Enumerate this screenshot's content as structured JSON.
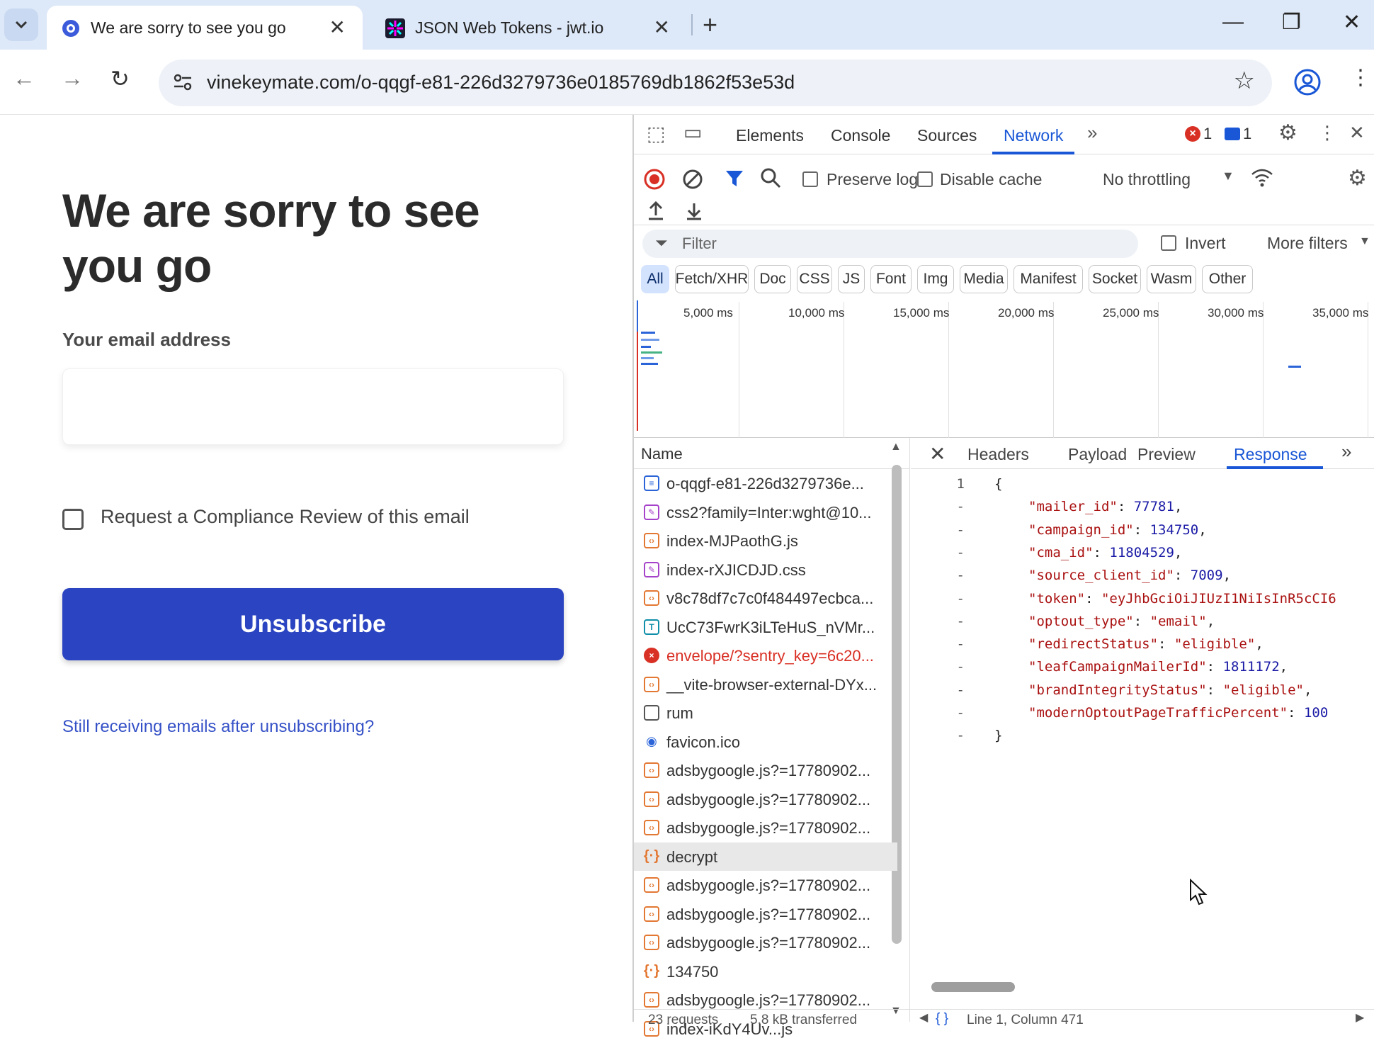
{
  "browser": {
    "tabs": [
      {
        "title": "We are sorry to see you go",
        "close": "✕"
      },
      {
        "title": "JSON Web Tokens - jwt.io",
        "close": "✕"
      }
    ],
    "url": "vinekeymate.com/o-qqgf-e81-226d3279736e0185769db1862f53e53d"
  },
  "page": {
    "heading": "We are sorry to see you go",
    "email_label": "Your email address",
    "email_value": "",
    "checkbox_label": "Request a Compliance Review of this email",
    "unsubscribe_label": "Unsubscribe",
    "still_link": "Still receiving emails after unsubscribing?"
  },
  "devtools": {
    "tabs": [
      "Elements",
      "Console",
      "Sources",
      "Network"
    ],
    "active_tab": "Network",
    "error_count": "1",
    "message_count": "1",
    "preserve_log": "Preserve log",
    "disable_cache": "Disable cache",
    "throttling": "No throttling",
    "filter_placeholder": "Filter",
    "invert": "Invert",
    "more_filters": "More filters",
    "type_filters": [
      "All",
      "Fetch/XHR",
      "Doc",
      "CSS",
      "JS",
      "Font",
      "Img",
      "Media",
      "Manifest",
      "Socket",
      "Wasm",
      "Other"
    ],
    "timeline_labels": [
      "5,000 ms",
      "10,000 ms",
      "15,000 ms",
      "20,000 ms",
      "25,000 ms",
      "30,000 ms",
      "35,000 ms"
    ],
    "name_header": "Name",
    "requests": [
      {
        "name": "o-qqgf-e81-226d3279736e...",
        "type": "doc"
      },
      {
        "name": "css2?family=Inter:wght@10...",
        "type": "css"
      },
      {
        "name": "index-MJPaothG.js",
        "type": "js"
      },
      {
        "name": "index-rXJICDJD.css",
        "type": "css"
      },
      {
        "name": "v8c78df7c7c0f484497ecbca...",
        "type": "js"
      },
      {
        "name": "UcC73FwrK3iLTeHuS_nVMr...",
        "type": "font"
      },
      {
        "name": "envelope/?sentry_key=6c20...",
        "type": "err"
      },
      {
        "name": "__vite-browser-external-DYx...",
        "type": "js"
      },
      {
        "name": "rum",
        "type": "other"
      },
      {
        "name": "favicon.ico",
        "type": "fav"
      },
      {
        "name": "adsbygoogle.js?=17780902...",
        "type": "js"
      },
      {
        "name": "adsbygoogle.js?=17780902...",
        "type": "js"
      },
      {
        "name": "adsbygoogle.js?=17780902...",
        "type": "js"
      },
      {
        "name": "decrypt",
        "type": "xhr"
      },
      {
        "name": "adsbygoogle.js?=17780902...",
        "type": "js"
      },
      {
        "name": "adsbygoogle.js?=17780902...",
        "type": "js"
      },
      {
        "name": "adsbygoogle.js?=17780902...",
        "type": "js"
      },
      {
        "name": "134750",
        "type": "xhr"
      },
      {
        "name": "adsbygoogle.js?=17780902...",
        "type": "js"
      },
      {
        "name": "index-iKdY4Uv...js",
        "type": "js"
      }
    ],
    "selected_request": "decrypt",
    "detail_tabs": [
      "Headers",
      "Payload",
      "Preview",
      "Response"
    ],
    "detail_active": "Response",
    "response_lines": [
      {
        "num": "1",
        "text": "{"
      },
      {
        "num": "-",
        "key": "\"mailer_id\"",
        "value": "77781",
        "vtype": "num",
        "comma": ","
      },
      {
        "num": "-",
        "key": "\"campaign_id\"",
        "value": "134750",
        "vtype": "num",
        "comma": ","
      },
      {
        "num": "-",
        "key": "\"cma_id\"",
        "value": "11804529",
        "vtype": "num",
        "comma": ","
      },
      {
        "num": "-",
        "key": "\"source_client_id\"",
        "value": "7009",
        "vtype": "num",
        "comma": ","
      },
      {
        "num": "-",
        "key": "\"token\"",
        "value": "\"eyJhbGciOiJIUzI1NiIsInR5cCI6",
        "vtype": "str",
        "comma": ""
      },
      {
        "num": "-",
        "key": "\"optout_type\"",
        "value": "\"email\"",
        "vtype": "str",
        "comma": ","
      },
      {
        "num": "-",
        "key": "\"redirectStatus\"",
        "value": "\"eligible\"",
        "vtype": "str",
        "comma": ","
      },
      {
        "num": "-",
        "key": "\"leafCampaignMailerId\"",
        "value": "1811172",
        "vtype": "num",
        "comma": ","
      },
      {
        "num": "-",
        "key": "\"brandIntegrityStatus\"",
        "value": "\"eligible\"",
        "vtype": "str",
        "comma": ","
      },
      {
        "num": "-",
        "key": "\"modernOptoutPageTrafficPercent\"",
        "value": "100",
        "vtype": "num",
        "comma": ""
      },
      {
        "num": "-",
        "text": "}"
      }
    ],
    "status_left": "23 requests",
    "status_mid": "5.8 kB transferred",
    "status_right": "Line 1, Column 471"
  },
  "colors": {
    "accent": "#1a57d6",
    "button": "#2b44c1",
    "error": "#d93025"
  },
  "icons": [
    "tab-search-icon",
    "favicon-icon",
    "jwt-icon",
    "back-icon",
    "forward-icon",
    "reload-icon",
    "site-settings-icon",
    "star-icon",
    "profile-icon",
    "more-icon",
    "inspect-icon",
    "device-icon",
    "gear-icon",
    "record-icon",
    "clear-icon",
    "filter-icon",
    "search-icon",
    "wifi-icon",
    "upload-icon",
    "download-icon"
  ]
}
